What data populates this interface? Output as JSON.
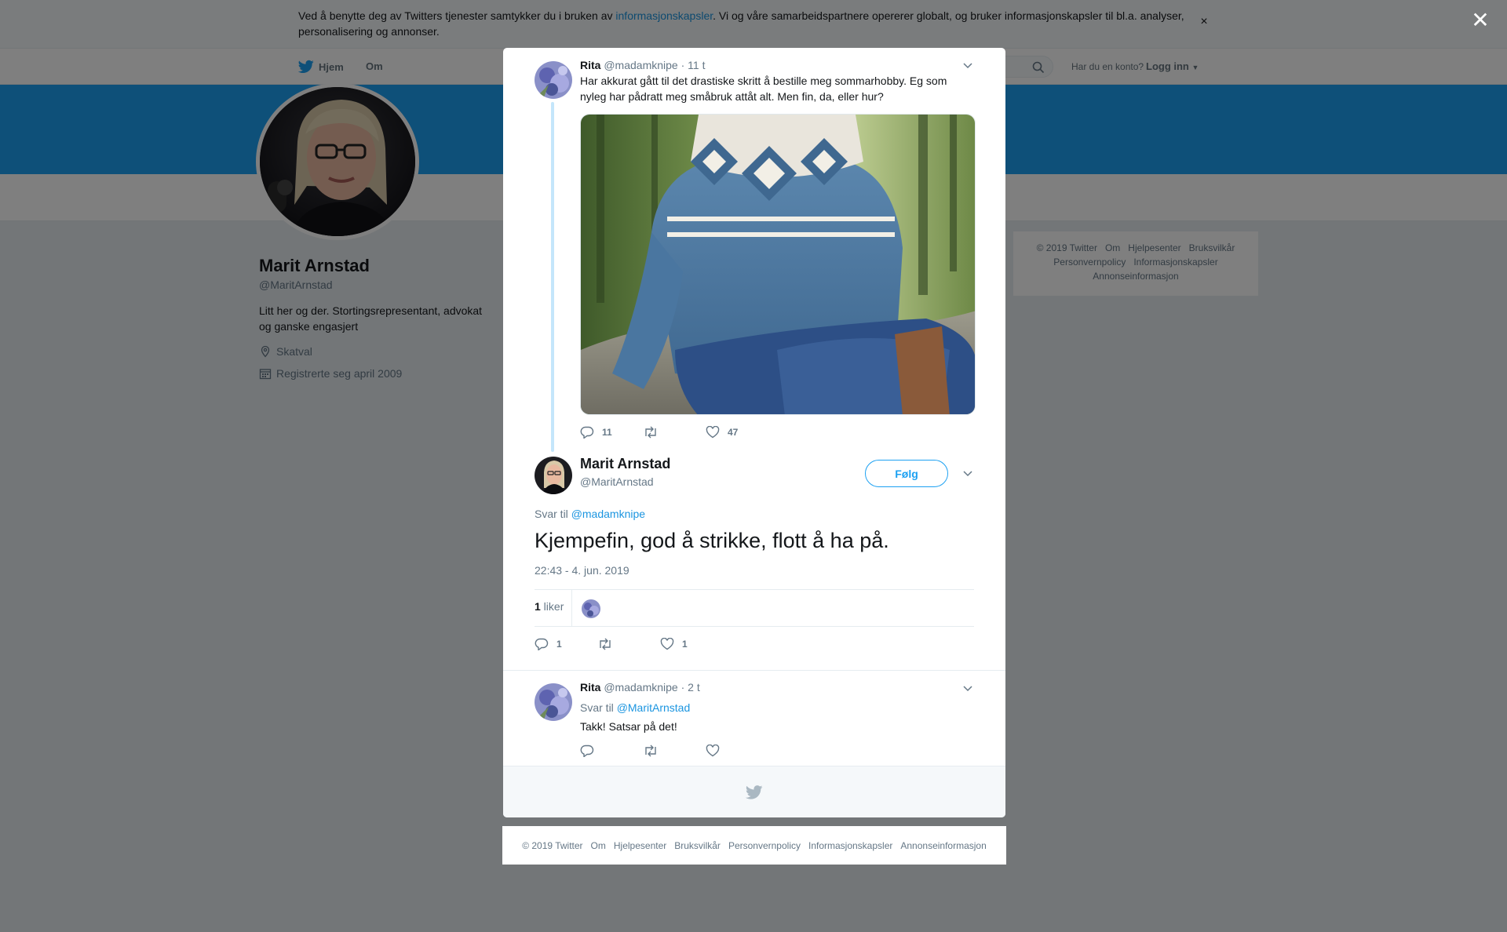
{
  "cookie": {
    "text_before": "Ved å benytte deg av Twitters tjenester samtykker du i bruken av ",
    "link": "informasjonskapsler",
    "text_after": ". Vi og våre samarbeidspartnere opererer globalt, og bruker informasjonskapsler til bl.a. analyser, personalisering og annonser.",
    "close": "×"
  },
  "nav": {
    "home": "Hjem",
    "about": "Om",
    "login_question": "Har du en konto?",
    "login": "Logg inn"
  },
  "profile": {
    "name": "Marit Arnstad",
    "handle": "@MaritArnstad",
    "bio": "Litt her og der. Stortingsrepresentant, advokat og ganske engasjert",
    "location": "Skatval",
    "joined": "Registrerte seg april 2009"
  },
  "side_footer": [
    "© 2019 Twitter",
    "Om",
    "Hjelpesenter",
    "Bruksvilkår",
    "Personvernpolicy",
    "Informasjonskapsler",
    "Annonseinformasjon"
  ],
  "overlay_close": "✕",
  "modal": {
    "parent": {
      "name": "Rita",
      "handle": "@madamknipe",
      "time": "· 11 t",
      "text": "Har akkurat gått til det drastiske skritt å bestille meg sommarhobby. Eg som nyleg har pådratt meg småbruk attåt alt. Men fin, da, eller hur?",
      "replies": "11",
      "retweets": "",
      "likes": "47"
    },
    "main": {
      "name": "Marit Arnstad",
      "handle": "@MaritArnstad",
      "follow": "Følg",
      "reply_to_prefix": "Svar til ",
      "reply_to_handle": "@madamknipe",
      "text": "Kjempefin, god å strikke, flott å ha på.",
      "timestamp": "22:43 - 4. jun. 2019",
      "likes_count": "1",
      "likes_label": " liker",
      "replies": "1",
      "retweets": "",
      "likes": "1"
    },
    "reply": {
      "name": "Rita",
      "handle": "@madamknipe",
      "time": "· 2 t",
      "reply_to_prefix": "Svar til ",
      "reply_to_handle": "@MaritArnstad",
      "text": "Takk! Satsar på det!"
    }
  },
  "bottom_footer": [
    "© 2019 Twitter",
    "Om",
    "Hjelpesenter",
    "Bruksvilkår",
    "Personvernpolicy",
    "Informasjonskapsler",
    "Annonseinformasjon"
  ],
  "colors": {
    "accent": "#1da1f2",
    "link": "#1b95e0",
    "muted": "#657786",
    "banner": "#1da1f2"
  }
}
